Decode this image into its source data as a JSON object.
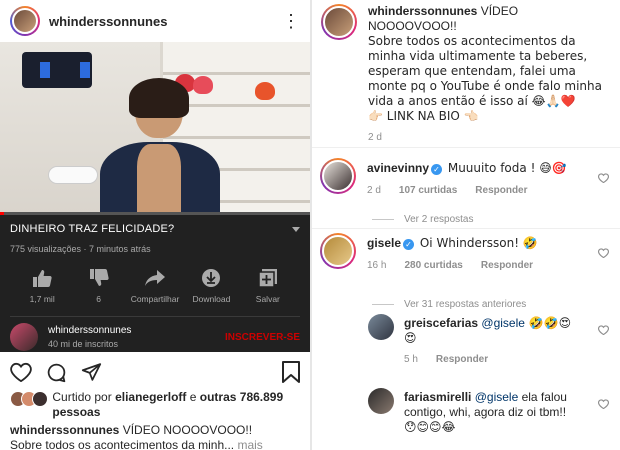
{
  "left": {
    "post_username": "whinderssonnunes",
    "youtube": {
      "title": "DINHEIRO TRAZ FELICIDADE?",
      "meta": "775 visualizações · 7 minutos atrás",
      "progress": 0.013,
      "actions": [
        {
          "label": "1,7 mil",
          "icon": "thumbs-up-icon"
        },
        {
          "label": "6",
          "icon": "thumbs-down-icon"
        },
        {
          "label": "Compartilhar",
          "icon": "share-icon"
        },
        {
          "label": "Download",
          "icon": "download-icon"
        },
        {
          "label": "Salvar",
          "icon": "save-playlist-icon"
        }
      ],
      "channel_name": "whinderssonnunes",
      "channel_subs": "40 mi de inscritos",
      "subscribe_label": "INSCREVER-SE"
    },
    "liked_by_prefix": "Curtido por ",
    "liked_by_user": "elianegerloff",
    "liked_by_middle": " e ",
    "liked_by_rest": "outras 786.899 pessoas",
    "caption_user": "whinderssonnunes",
    "caption_text": " VÍDEO NOOOOVOOO!!",
    "caption_preview": "Sobre todos os acontecimentos da minh...",
    "caption_more": " mais"
  },
  "right": {
    "main_comment": {
      "user": "whinderssonnunes",
      "text_head": " VÍDEO NOOOOVOOO!!",
      "text_body": "Sobre todos os acontecimentos da minha vida ultimamente ta beberes, esperam que entendam, falei uma monte pq o YouTube é onde falo minha vida a anos então é isso aí 😂🙏🏻❤️",
      "link": "👉🏻 LINK NA BIO 👈🏻",
      "time": "2 d"
    },
    "comments": [
      {
        "user": "avinevinny",
        "text": " Muuuito foda ! 😅🎯",
        "time": "2 d",
        "likes": "107 curtidas",
        "reply": "Responder",
        "replies_label": "Ver 2 respostas"
      },
      {
        "user": "gisele",
        "text": " Oi Whindersson! 🤣",
        "time": "16 h",
        "likes": "280 curtidas",
        "reply": "Responder",
        "replies_label": "Ver 31 respostas anteriores"
      }
    ],
    "replies": [
      {
        "user": "greiscefarias",
        "mention": " @gisele",
        "text": " 🤣🤣😍",
        "text2": "😍",
        "time": "5 h",
        "reply": "Responder"
      },
      {
        "user": "fariasmirelli",
        "mention": " @gisele",
        "text": " ela falou contigo, whi, agora diz oi tbm!!",
        "text2": "😯😊😊😂"
      }
    ]
  }
}
